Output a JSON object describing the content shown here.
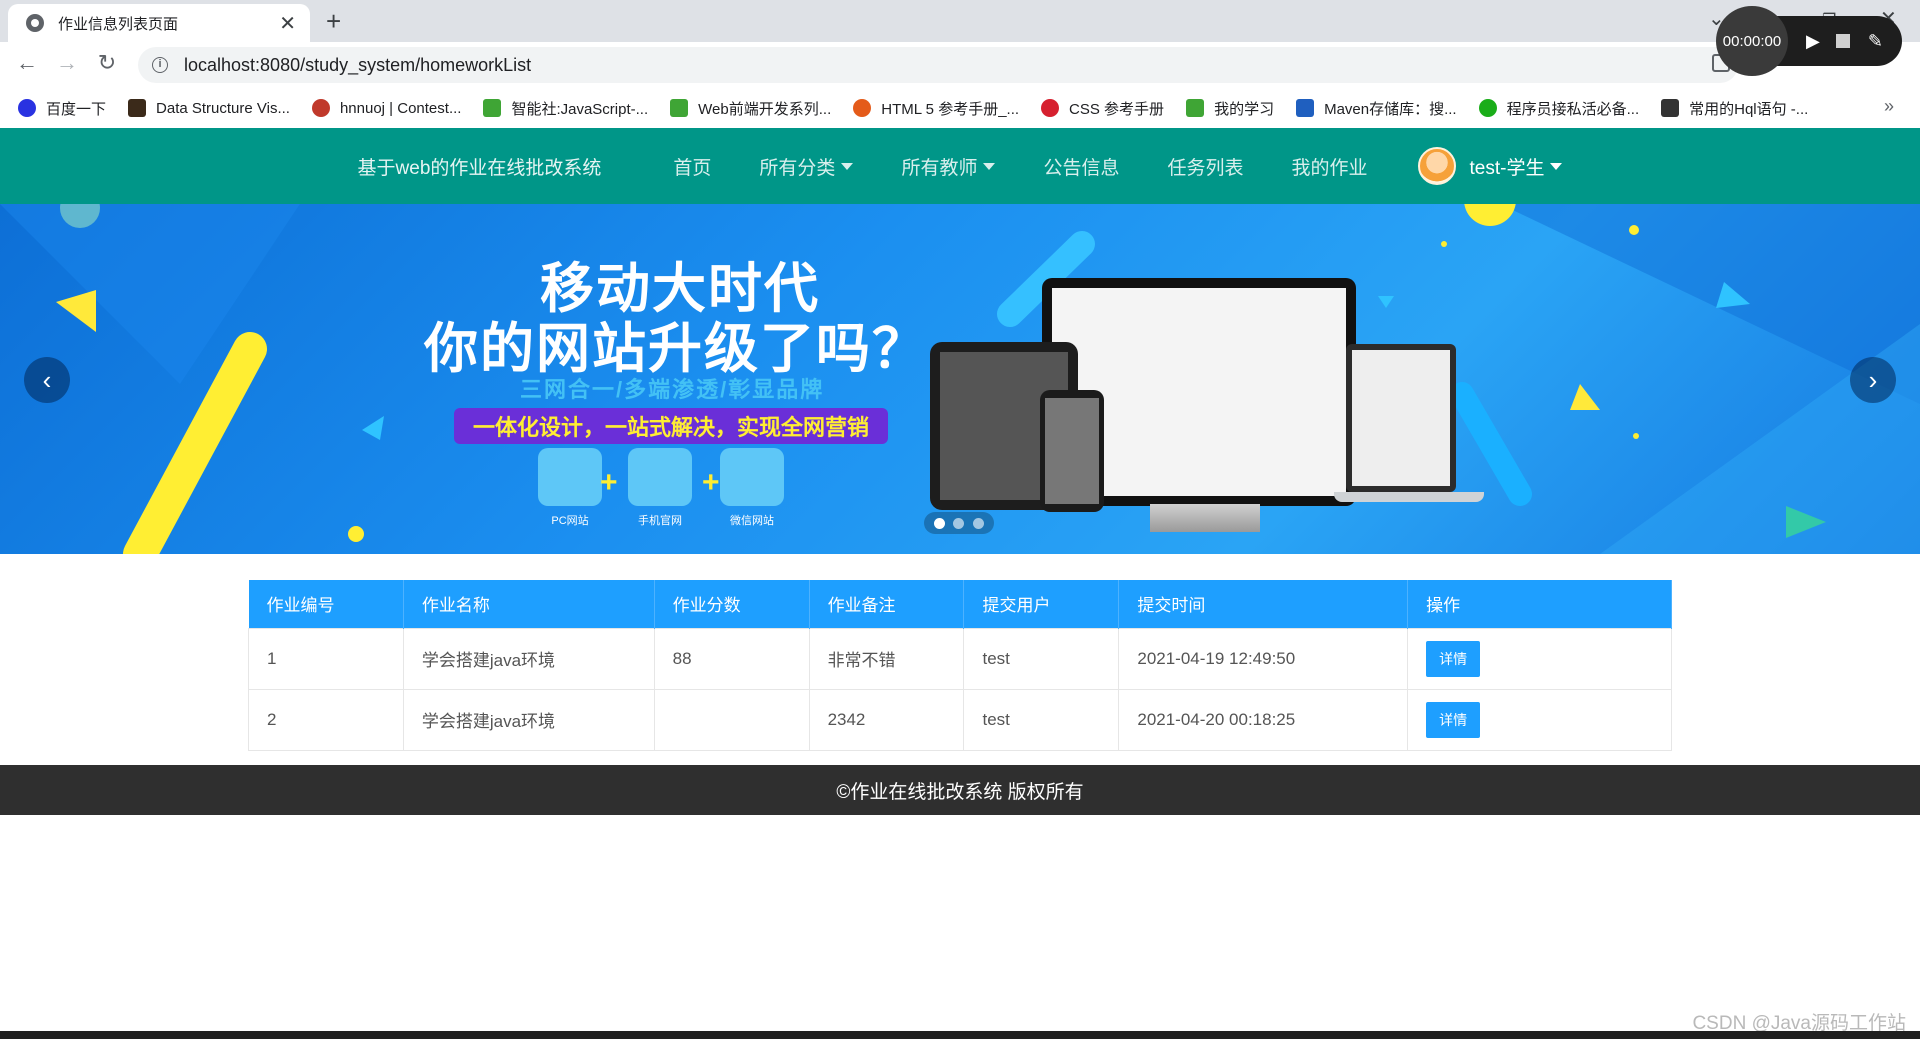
{
  "browser": {
    "tab_title": "作业信息列表页面",
    "url": "localhost:8080/study_system/homeworkList",
    "recorder_time": "00:00:00"
  },
  "bookmarks": [
    {
      "label": "百度一下",
      "color": "#2932e1"
    },
    {
      "label": "Data Structure Vis...",
      "color": "#3b2a1a"
    },
    {
      "label": "hnnuoj | Contest...",
      "color": "#c0392b"
    },
    {
      "label": "智能社:JavaScript-...",
      "color": "#3fa535"
    },
    {
      "label": "Web前端开发系列...",
      "color": "#3fa535"
    },
    {
      "label": "HTML 5 参考手册_...",
      "color": "#e45b1a"
    },
    {
      "label": "CSS 参考手册",
      "color": "#d6202f"
    },
    {
      "label": "我的学习",
      "color": "#3fa535"
    },
    {
      "label": "Maven存储库：搜...",
      "color": "#1f5fbf"
    },
    {
      "label": "程序员接私活必备...",
      "color": "#1aad19"
    },
    {
      "label": "常用的Hql语句 -...",
      "color": "#333333"
    }
  ],
  "site_nav": {
    "brand": "基于web的作业在线批改系统",
    "items": [
      "首页",
      "所有分类",
      "所有教师",
      "公告信息",
      "任务列表",
      "我的作业"
    ],
    "user": "test-学生"
  },
  "banner": {
    "line1": "移动大时代",
    "line2": "你的网站升级了吗？",
    "line3": "三网合一/多端渗透/彰显品牌",
    "slogan": "一体化设计，一站式解决，实现全网营销",
    "devices": [
      "PC网站",
      "手机官网",
      "微信网站"
    ]
  },
  "table": {
    "headers": [
      "作业编号",
      "作业名称",
      "作业分数",
      "作业备注",
      "提交用户",
      "提交时间",
      "操作"
    ],
    "rows": [
      {
        "id": "1",
        "name": "学会搭建java环境",
        "score": "88",
        "note": "非常不错",
        "user": "test",
        "time": "2021-04-19 12:49:50",
        "action": "详情"
      },
      {
        "id": "2",
        "name": "学会搭建java环境",
        "score": "",
        "note": "2342",
        "user": "test",
        "time": "2021-04-20 00:18:25",
        "action": "详情"
      }
    ]
  },
  "footer": "©作业在线批改系统 版权所有",
  "watermark": "CSDN @Java源码工作站"
}
